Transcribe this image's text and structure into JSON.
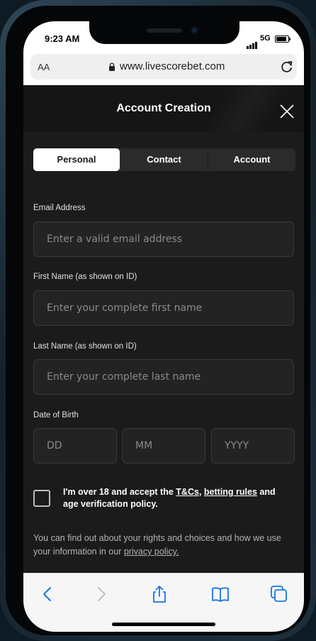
{
  "status": {
    "time": "9:23 AM",
    "network": "5G"
  },
  "browser": {
    "text_size": "AA",
    "url": "www.livescorebet.com"
  },
  "modal": {
    "title": "Account Creation"
  },
  "tabs": [
    {
      "label": "Personal",
      "active": true
    },
    {
      "label": "Contact",
      "active": false
    },
    {
      "label": "Account",
      "active": false
    }
  ],
  "form": {
    "email": {
      "label": "Email Address",
      "placeholder": "Enter a valid email address",
      "value": ""
    },
    "first_name": {
      "label": "First Name (as shown on ID)",
      "placeholder": "Enter your complete first name",
      "value": ""
    },
    "last_name": {
      "label": "Last Name (as shown on ID)",
      "placeholder": "Enter your complete last name",
      "value": ""
    },
    "dob": {
      "label": "Date of Birth",
      "day_placeholder": "DD",
      "month_placeholder": "MM",
      "year_placeholder": "YYYY"
    }
  },
  "consent": {
    "text_before": "I'm over 18 and accept the ",
    "tnc_link": "T&Cs",
    "separator": ", ",
    "betting_rules_link": "betting rules",
    "text_after": " and age verification policy.",
    "checked": false
  },
  "info": {
    "text": "You can find out about your rights and choices and how we use your information in our ",
    "privacy_link": "privacy policy."
  },
  "colors": {
    "background": "#1b1b1b",
    "accent": "#ffffff",
    "safari_blue": "#1a73e8"
  },
  "icons": [
    "lock-icon",
    "reload-icon",
    "close-icon",
    "back-icon",
    "forward-icon",
    "share-icon",
    "bookmarks-icon",
    "tabs-icon"
  ]
}
